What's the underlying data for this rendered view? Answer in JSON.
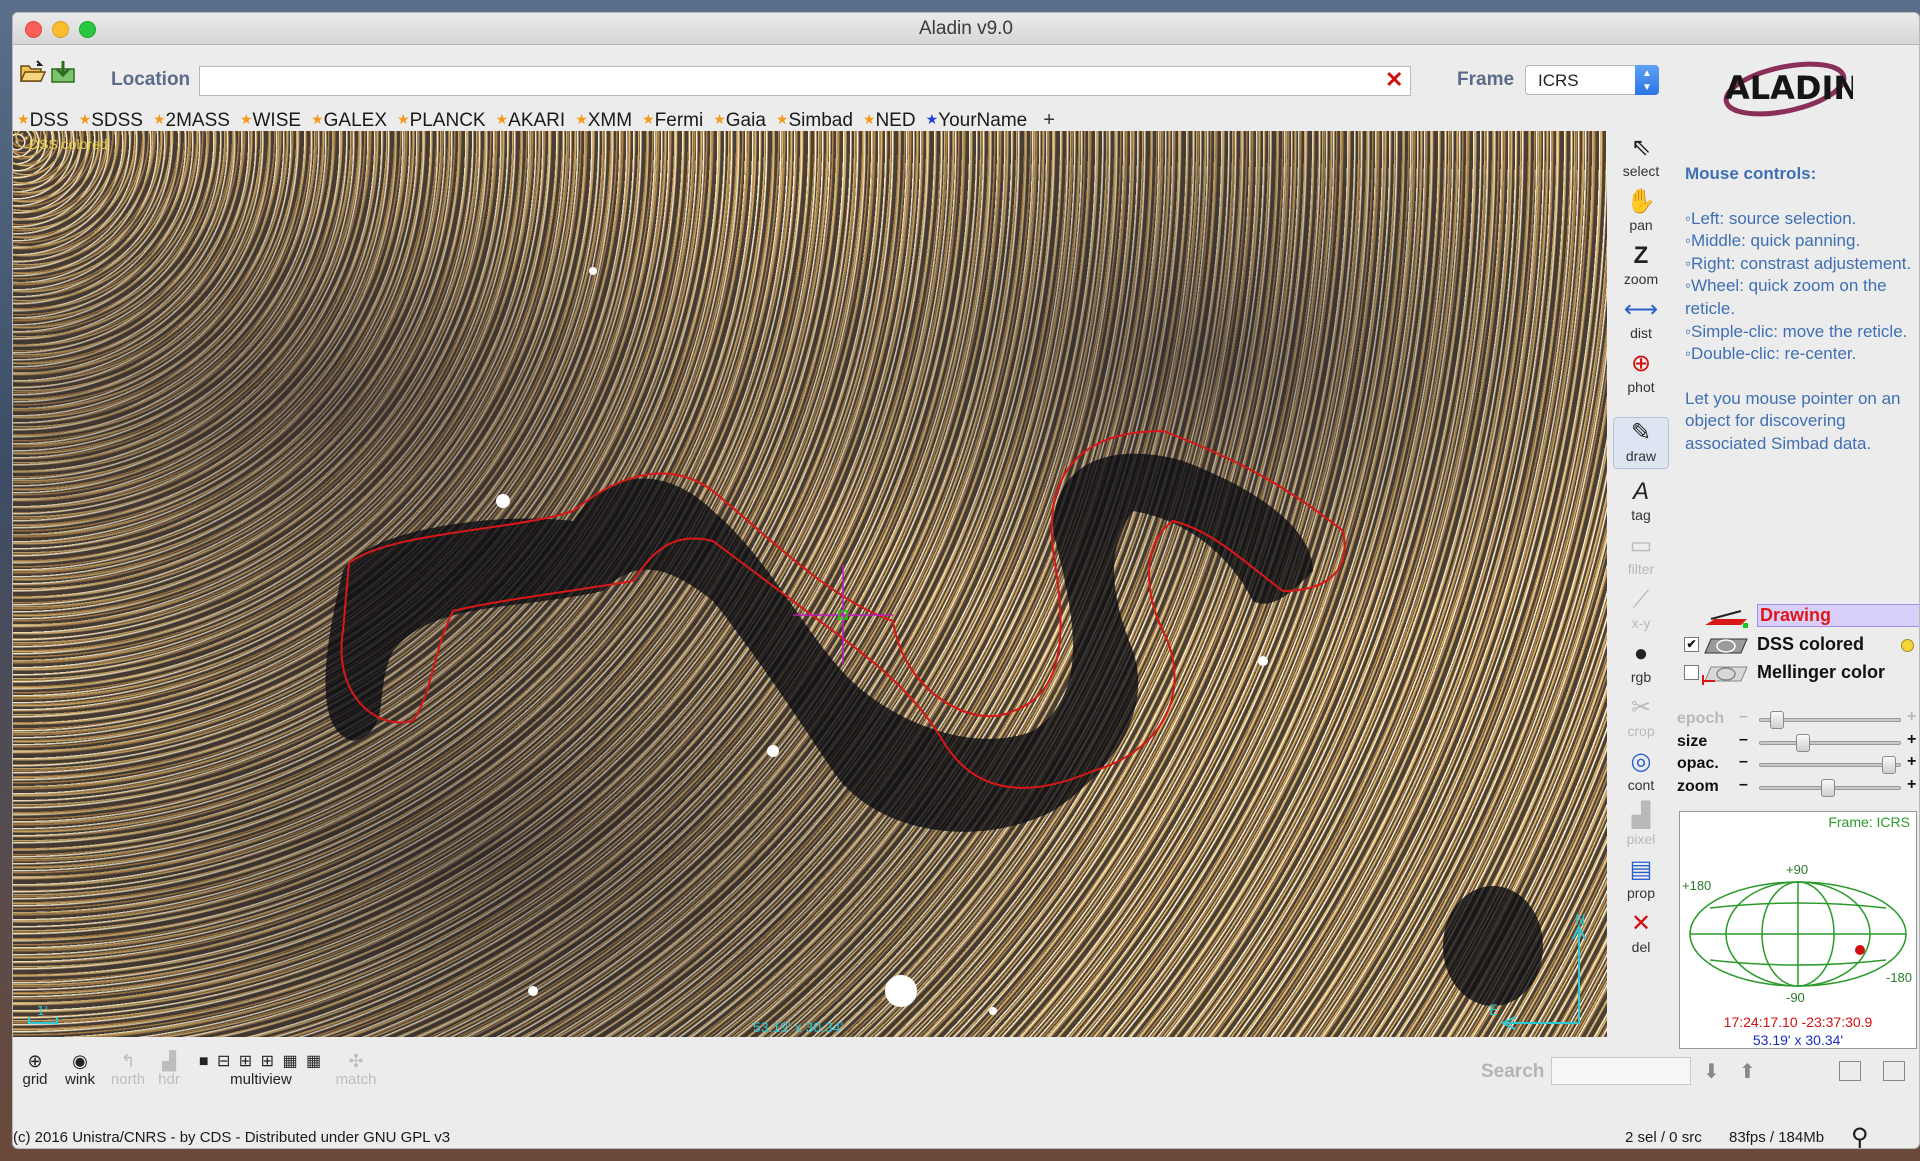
{
  "window": {
    "title": "Aladin v9.0"
  },
  "toolbar": {
    "open_icon": "folder-open-icon",
    "save_icon": "save-download-icon",
    "location_label": "Location",
    "location_value": "",
    "frame_label": "Frame",
    "frame_value": "ICRS"
  },
  "logo": {
    "text": "ALADIN"
  },
  "surveys": [
    {
      "label": "DSS",
      "star_color": "#f29a1b"
    },
    {
      "label": "SDSS",
      "star_color": "#f29a1b"
    },
    {
      "label": "2MASS",
      "star_color": "#f29a1b"
    },
    {
      "label": "WISE",
      "star_color": "#f29a1b"
    },
    {
      "label": "GALEX",
      "star_color": "#f29a1b"
    },
    {
      "label": "PLANCK",
      "star_color": "#f29a1b"
    },
    {
      "label": "AKARI",
      "star_color": "#f29a1b"
    },
    {
      "label": "XMM",
      "star_color": "#f29a1b"
    },
    {
      "label": "Fermi",
      "star_color": "#f29a1b"
    },
    {
      "label": "Gaia",
      "star_color": "#f29a1b"
    },
    {
      "label": "Simbad",
      "star_color": "#f29a1b"
    },
    {
      "label": "NED",
      "star_color": "#f29a1b"
    },
    {
      "label": "YourName",
      "star_color": "#1a3ee0"
    }
  ],
  "surveys_add": "+",
  "view": {
    "layer_label": "DSS colored",
    "field_size": "53.19' x 30.34'",
    "compass_north": "N",
    "compass_east": "E",
    "scale_label": "1'"
  },
  "tools": {
    "select": "select",
    "pan": "pan",
    "zoom": "zoom",
    "dist": "dist",
    "phot": "phot",
    "draw": "draw",
    "tag": "tag",
    "filter": "filter",
    "xy": "x-y",
    "rgb": "rgb",
    "crop": "crop",
    "cont": "cont",
    "pixel": "pixel",
    "prop": "prop",
    "del": "del"
  },
  "help": {
    "title": "Mouse controls:",
    "items": [
      "◦Left: source selection.",
      "◦Middle: quick panning.",
      "◦Right: constrast adjustement.",
      "◦Wheel: quick zoom on the reticle.",
      "◦Simple-clic: move the reticle.",
      "◦Double-clic: re-center."
    ],
    "note": "Let you mouse pointer on an object for discovering associated Simbad data."
  },
  "stack": {
    "planes": [
      {
        "name": "Drawing",
        "checked": false,
        "selected": true
      },
      {
        "name": "DSS colored",
        "checked": true,
        "selected": false
      },
      {
        "name": "Mellinger color",
        "checked": false,
        "selected": false
      }
    ]
  },
  "sliders": {
    "epoch": {
      "label": "epoch",
      "value": 0.08
    },
    "size": {
      "label": "size",
      "value": 0.28
    },
    "opac": {
      "label": "opac.",
      "value": 0.95
    },
    "zoom": {
      "label": "zoom",
      "value": 0.48
    }
  },
  "minimap": {
    "frame": "Frame: ICRS",
    "lat_top": "+90",
    "lat_bottom": "-90",
    "lon_left": "+180",
    "lon_right": "-180",
    "coords": "17:24:17.10 -23:37:30.9",
    "size": "53.19' x 30.34'"
  },
  "bottom": {
    "grid": "grid",
    "wink": "wink",
    "north": "north",
    "hdr": "hdr",
    "multiview": "multiview",
    "match": "match",
    "search_label": "Search",
    "search_value": ""
  },
  "status": {
    "copyright": "(c) 2016 Unistra/CNRS - by CDS - Distributed under GNU GPL v3",
    "selection": "2 sel / 0 src",
    "performance": "83fps / 184Mb"
  },
  "colors": {
    "contour": "#d81818",
    "help_text": "#3f6fb4",
    "label_blue": "#5c6b8a",
    "selected_plane": "#d8d0fa"
  }
}
